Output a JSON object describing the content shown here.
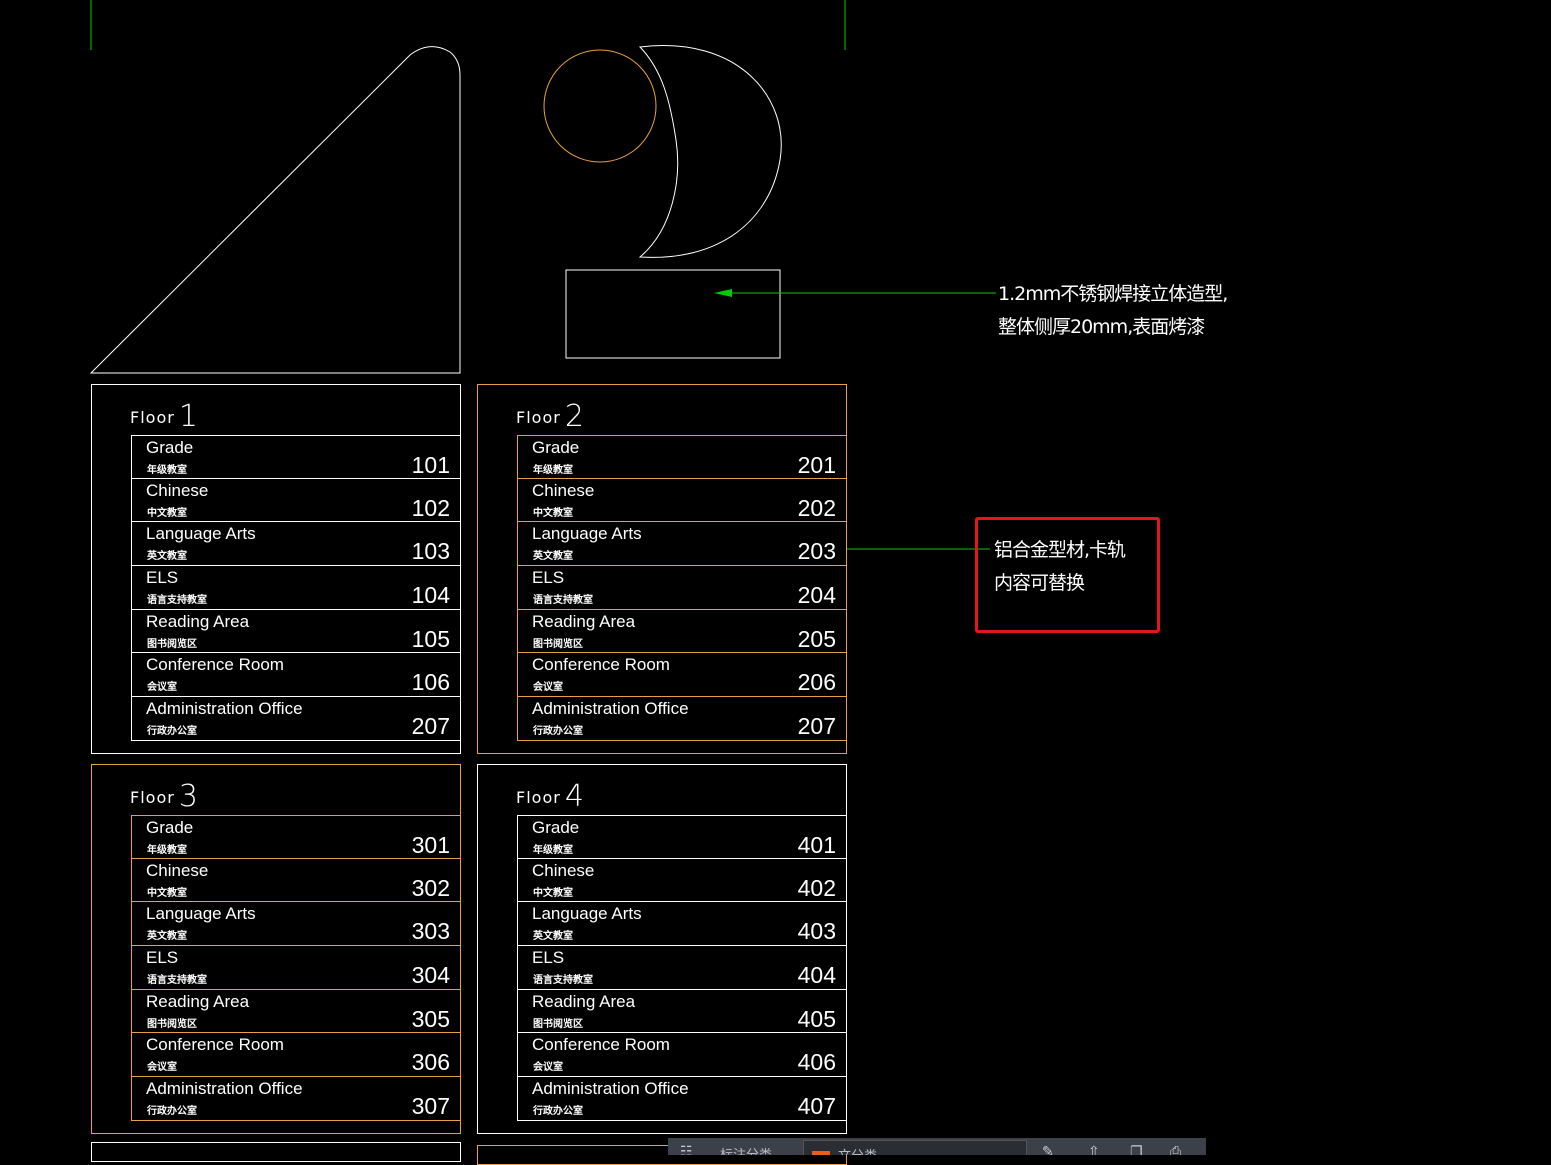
{
  "annotations": {
    "steel_note": [
      "1.2mm不锈钢焊接立体造型,",
      "整体侧厚20mm,表面烤漆"
    ],
    "aluminum_note": [
      "铝合金型材,卡轨",
      "内容可替换"
    ]
  },
  "colors": {
    "background": "#000000",
    "line_white": "#ffffff",
    "line_orange": "#e8a042",
    "leader_green": "#00cc00",
    "highlight_red": "#e8141b"
  },
  "floor_prefix": "Floor",
  "floors": [
    {
      "number": "1",
      "border": "white",
      "rows": [
        {
          "en": "Grade",
          "cn": "年级教室",
          "room": "101"
        },
        {
          "en": "Chinese",
          "cn": "中文教室",
          "room": "102"
        },
        {
          "en": "Language Arts",
          "cn": "英文教室",
          "room": "103"
        },
        {
          "en": "ELS",
          "cn": "语言支持教室",
          "room": "104"
        },
        {
          "en": "Reading Area",
          "cn": "图书阅览区",
          "room": "105"
        },
        {
          "en": "Conference Room",
          "cn": "会议室",
          "room": "106"
        },
        {
          "en": "Administration Office",
          "cn": "行政办公室",
          "room": "207"
        }
      ]
    },
    {
      "number": "2",
      "border": "orange",
      "rows": [
        {
          "en": "Grade",
          "cn": "年级教室",
          "room": "201"
        },
        {
          "en": "Chinese",
          "cn": "中文教室",
          "room": "202"
        },
        {
          "en": "Language Arts",
          "cn": "英文教室",
          "room": "203"
        },
        {
          "en": "ELS",
          "cn": "语言支持教室",
          "room": "204"
        },
        {
          "en": "Reading Area",
          "cn": "图书阅览区",
          "room": "205"
        },
        {
          "en": "Conference Room",
          "cn": "会议室",
          "room": "206"
        },
        {
          "en": "Administration Office",
          "cn": "行政办公室",
          "room": "207"
        }
      ]
    },
    {
      "number": "3",
      "border": "orange",
      "rows": [
        {
          "en": "Grade",
          "cn": "年级教室",
          "room": "301"
        },
        {
          "en": "Chinese",
          "cn": "中文教室",
          "room": "302"
        },
        {
          "en": "Language Arts",
          "cn": "英文教室",
          "room": "303"
        },
        {
          "en": "ELS",
          "cn": "语言支持教室",
          "room": "304"
        },
        {
          "en": "Reading Area",
          "cn": "图书阅览区",
          "room": "305"
        },
        {
          "en": "Conference Room",
          "cn": "会议室",
          "room": "306"
        },
        {
          "en": "Administration Office",
          "cn": "行政办公室",
          "room": "307"
        }
      ]
    },
    {
      "number": "4",
      "border": "white",
      "rows": [
        {
          "en": "Grade",
          "cn": "年级教室",
          "room": "401"
        },
        {
          "en": "Chinese",
          "cn": "中文教室",
          "room": "402"
        },
        {
          "en": "Language Arts",
          "cn": "英文教室",
          "room": "403"
        },
        {
          "en": "ELS",
          "cn": "语言支持教室",
          "room": "404"
        },
        {
          "en": "Reading Area",
          "cn": "图书阅览区",
          "room": "405"
        },
        {
          "en": "Conference Room",
          "cn": "会议室",
          "room": "406"
        },
        {
          "en": "Administration Office",
          "cn": "行政办公室",
          "room": "407"
        }
      ]
    }
  ],
  "toolbar": {
    "left_text": "标注分类",
    "tab_text": "文分类",
    "icons": [
      "draw-icon",
      "upload-icon",
      "copy-icon",
      "print-icon"
    ]
  }
}
